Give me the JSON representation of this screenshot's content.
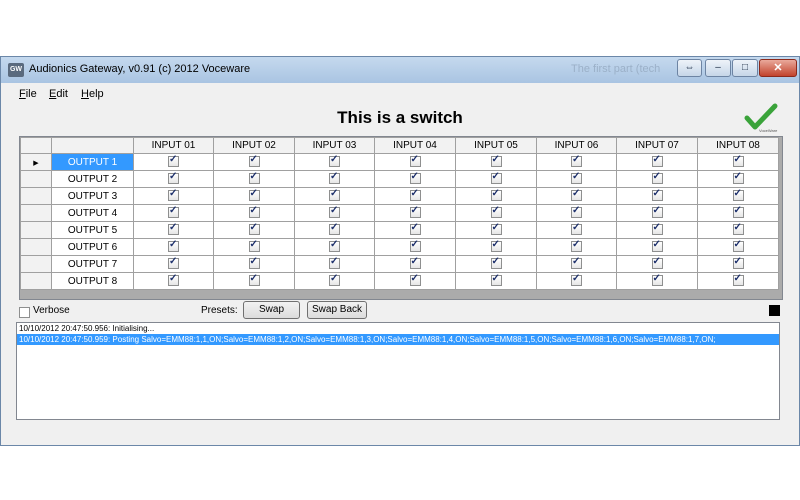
{
  "window": {
    "icon_text": "GW",
    "title": "Audionics Gateway, v0.91 (c) 2012 Voceware",
    "ghost_title": "The first part (tech"
  },
  "menu": [
    "File",
    "Edit",
    "Help"
  ],
  "heading": "This is a switch",
  "logo": {
    "name": "voceware-check-logo",
    "text": "VoceWare",
    "color": "#3aa33a"
  },
  "grid": {
    "columns": [
      "INPUT 01",
      "INPUT 02",
      "INPUT 03",
      "INPUT 04",
      "INPUT 05",
      "INPUT 06",
      "INPUT 07",
      "INPUT 08"
    ],
    "rows": [
      {
        "label": "OUTPUT 1",
        "selected": true,
        "checks": [
          true,
          true,
          true,
          true,
          true,
          true,
          true,
          true
        ]
      },
      {
        "label": "OUTPUT 2",
        "selected": false,
        "checks": [
          true,
          true,
          true,
          true,
          true,
          true,
          true,
          true
        ]
      },
      {
        "label": "OUTPUT 3",
        "selected": false,
        "checks": [
          true,
          true,
          true,
          true,
          true,
          true,
          true,
          true
        ]
      },
      {
        "label": "OUTPUT 4",
        "selected": false,
        "checks": [
          true,
          true,
          true,
          true,
          true,
          true,
          true,
          true
        ]
      },
      {
        "label": "OUTPUT 5",
        "selected": false,
        "checks": [
          true,
          true,
          true,
          true,
          true,
          true,
          true,
          true
        ]
      },
      {
        "label": "OUTPUT 6",
        "selected": false,
        "checks": [
          true,
          true,
          true,
          true,
          true,
          true,
          true,
          true
        ]
      },
      {
        "label": "OUTPUT 7",
        "selected": false,
        "checks": [
          true,
          true,
          true,
          true,
          true,
          true,
          true,
          true
        ]
      },
      {
        "label": "OUTPUT 8",
        "selected": false,
        "checks": [
          true,
          true,
          true,
          true,
          true,
          true,
          true,
          true
        ]
      }
    ]
  },
  "controls": {
    "verbose_label": "Verbose",
    "verbose_checked": false,
    "presets_label": "Presets:",
    "swap_label": "Swap",
    "swap_back_label": "Swap Back"
  },
  "log": [
    {
      "text": "10/10/2012 20:47:50.956: Initialising...",
      "selected": false
    },
    {
      "text": "10/10/2012 20:47:50.959: Posting Salvo=EMM88:1,1,ON;Salvo=EMM88:1,2,ON;Salvo=EMM88:1,3,ON;Salvo=EMM88:1,4,ON;Salvo=EMM88:1,5,ON;Salvo=EMM88:1,6,ON;Salvo=EMM88:1,7,ON;",
      "selected": true
    }
  ],
  "colors": {
    "selection": "#3399ff",
    "close_button": "#c2432c"
  }
}
